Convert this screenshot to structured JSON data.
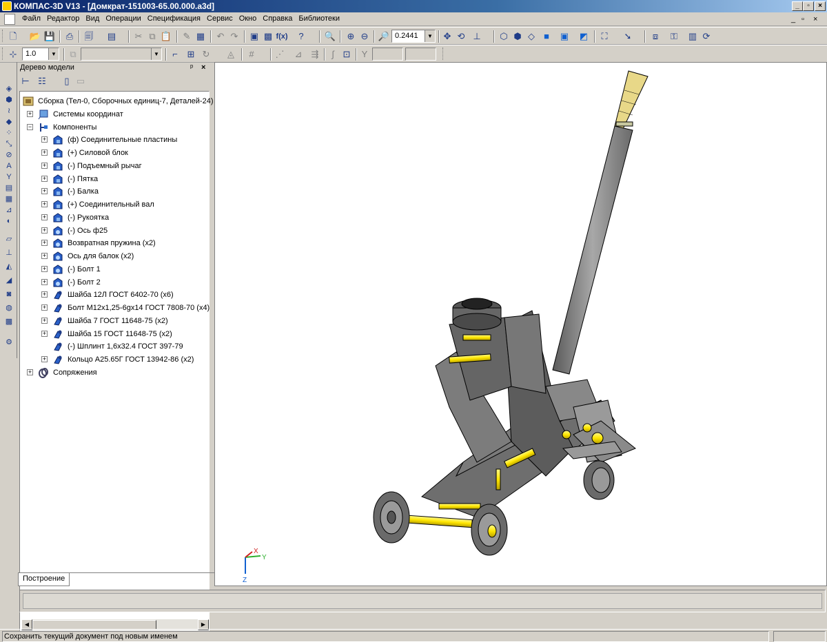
{
  "window": {
    "title": "КОМПАС-3D V13 - [Домкрат-151003-65.00.000.a3d]",
    "controls": [
      "_",
      "▫",
      "×"
    ]
  },
  "menu": {
    "items": [
      "Файл",
      "Редактор",
      "Вид",
      "Операции",
      "Спецификация",
      "Сервис",
      "Окно",
      "Справка",
      "Библиотеки"
    ],
    "doc_controls": [
      "_",
      "▫",
      "×"
    ]
  },
  "toolbar": {
    "zoom_value": "0.2441",
    "step_value": "1.0"
  },
  "tree": {
    "header": "Дерево модели",
    "pin": "ᵖ",
    "close": "×",
    "root": "Сборка (Тел-0, Сборочных единиц-7, Деталей-24)",
    "coord_systems": "Системы координат",
    "components_label": "Компоненты",
    "components": [
      {
        "label": "(ф) Соединительные пластины",
        "icon": "assembly"
      },
      {
        "label": "(+) Силовой блок",
        "icon": "assembly"
      },
      {
        "label": "(-) Подъемный рычаг",
        "icon": "assembly"
      },
      {
        "label": "(-) Пятка",
        "icon": "assembly"
      },
      {
        "label": "(-) Балка",
        "icon": "assembly"
      },
      {
        "label": "(+) Соединительный вал",
        "icon": "assembly"
      },
      {
        "label": "(-) Рукоятка",
        "icon": "assembly"
      },
      {
        "label": "(-) Ось ф25",
        "icon": "part"
      },
      {
        "label": "Возвратная пружина (x2)",
        "icon": "part"
      },
      {
        "label": "Ось для балок (x2)",
        "icon": "part"
      },
      {
        "label": "(-) Болт 1",
        "icon": "part"
      },
      {
        "label": "(-) Болт 2",
        "icon": "part"
      },
      {
        "label": "Шайба 12Л ГОСТ 6402-70 (x6)",
        "icon": "standard"
      },
      {
        "label": "Болт М12x1,25-6gx14 ГОСТ 7808-70 (x4)",
        "icon": "standard"
      },
      {
        "label": "Шайба 7 ГОСТ 11648-75 (x2)",
        "icon": "standard"
      },
      {
        "label": "Шайба 15 ГОСТ 11648-75 (x2)",
        "icon": "standard"
      },
      {
        "label": "(-) Шплинт 1,6x32.4 ГОСТ 397-79",
        "icon": "standard"
      },
      {
        "label": "Кольцо А25.65Г ГОСТ 13942-86 (x2)",
        "icon": "standard"
      }
    ],
    "mates": "Сопряжения"
  },
  "tab": {
    "label": "Построение"
  },
  "viewport": {
    "axes": {
      "x": "X",
      "y": "Y",
      "z": "Z"
    }
  },
  "status": {
    "text": "Сохранить текущий документ под новым именем"
  },
  "colors": {
    "title_start": "#0a246a",
    "title_end": "#a6caf0",
    "chrome": "#d4d0c8",
    "model_gray": "#8a8a8a",
    "model_yellow": "#ffee33"
  }
}
